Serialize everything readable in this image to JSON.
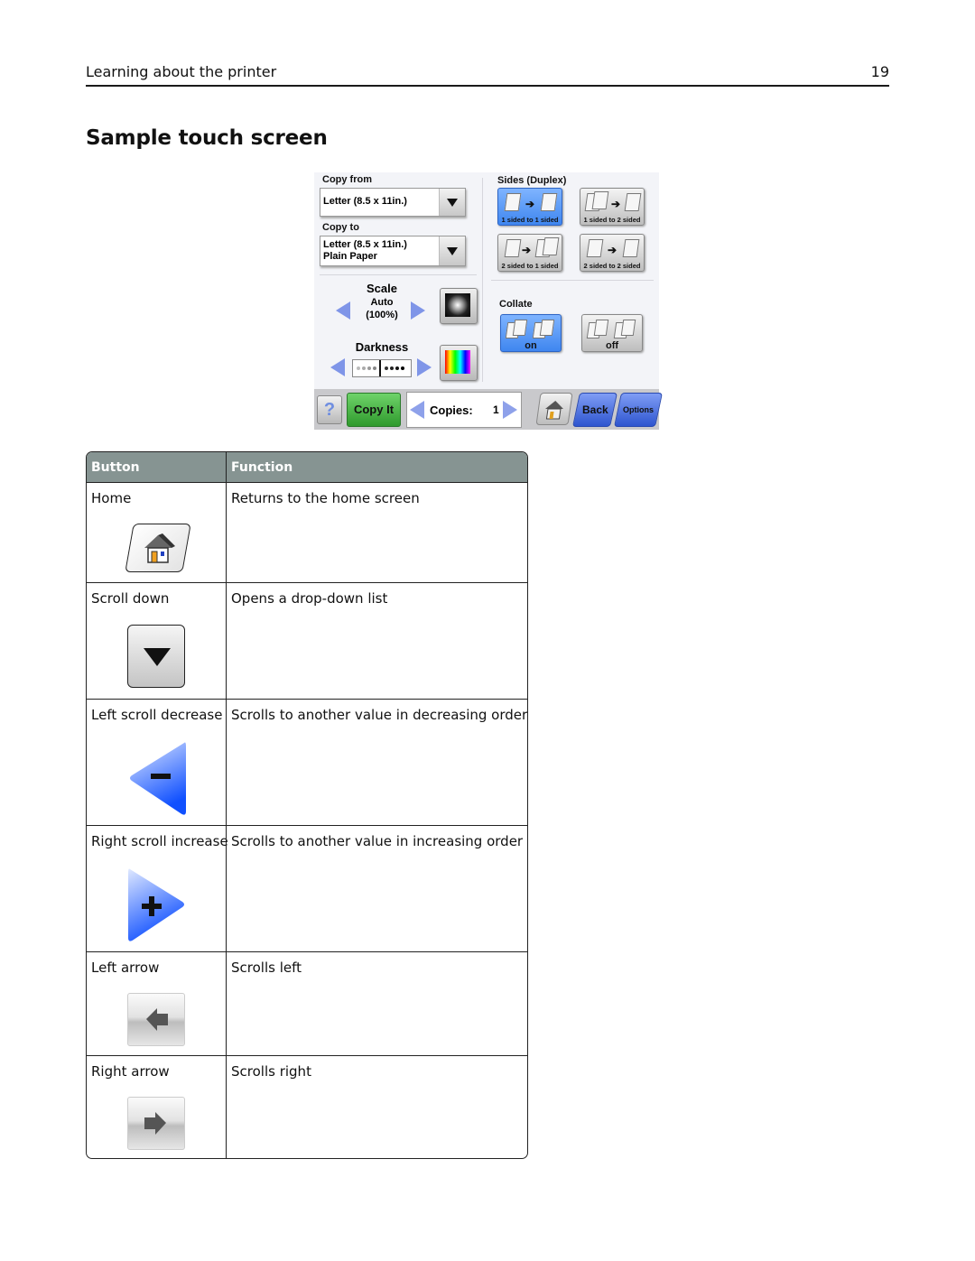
{
  "header": {
    "title": "Learning about the printer",
    "page_number": "19"
  },
  "section_title": "Sample touch screen",
  "touch_screen": {
    "copy_from": {
      "label": "Copy from",
      "value": "Letter (8.5 x 11in.)"
    },
    "copy_to": {
      "label": "Copy to",
      "value_line1": "Letter (8.5 x 11in.)",
      "value_line2": "Plain Paper"
    },
    "scale": {
      "label": "Scale",
      "value_line1": "Auto",
      "value_line2": "(100%)"
    },
    "darkness": {
      "label": "Darkness",
      "level": 5,
      "max": 9
    },
    "sides": {
      "label": "Sides (Duplex)",
      "options": [
        {
          "label": "1 sided to 1 sided",
          "selected": true
        },
        {
          "label": "1 sided to 2 sided",
          "selected": false
        },
        {
          "label": "2 sided to 1 sided",
          "selected": false
        },
        {
          "label": "2 sided to 2 sided",
          "selected": false
        }
      ]
    },
    "collate": {
      "label": "Collate",
      "options": [
        {
          "label": "on",
          "selected": true
        },
        {
          "label": "off",
          "selected": false
        }
      ]
    },
    "bottom_bar": {
      "help_icon": "?",
      "copy_it": "Copy It",
      "copies_label": "Copies:",
      "copies_value": "1",
      "back": "Back",
      "options": "Options"
    },
    "colors": {
      "selected_blue": "#4a8ff2",
      "copy_it_green": "#3fb23c",
      "nav_blue": "#4a6fe0",
      "arrow_blue": "#7f95e8"
    }
  },
  "table": {
    "headers": [
      "Button",
      "Function"
    ],
    "header_color": "#869492",
    "rows": [
      {
        "button": "Home",
        "function": "Returns to the home screen",
        "icon": "home-icon"
      },
      {
        "button": "Scroll down",
        "function": "Opens a drop-down list",
        "icon": "scroll-down-icon"
      },
      {
        "button": "Left scroll decrease",
        "function": "Scrolls to another value in decreasing order",
        "icon": "left-scroll-decrease-icon"
      },
      {
        "button": "Right scroll increase",
        "function": "Scrolls to another value in increasing order",
        "icon": "right-scroll-increase-icon"
      },
      {
        "button": "Left arrow",
        "function": "Scrolls left",
        "icon": "left-arrow-icon"
      },
      {
        "button": "Right arrow",
        "function": "Scrolls right",
        "icon": "right-arrow-icon"
      }
    ]
  }
}
